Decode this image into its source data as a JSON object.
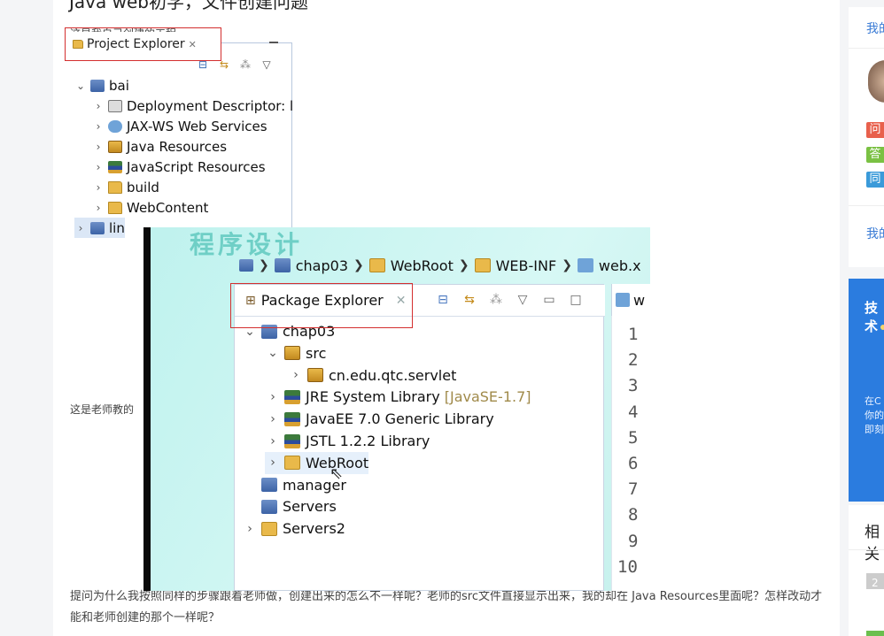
{
  "page": {
    "question_title": "Java web初学，文件创建问题",
    "caption_mine": "这是我自己创建的工程",
    "caption_teacher": "这是老师教的",
    "question_body": "提问为什么我按照同样的步骤跟着老师做，创建出来的怎么不一样呢？老师的src文件直接显示出来，我的却在 Java Resources里面呢？怎样改动才能和老师创建的那个一样呢？"
  },
  "my_project_explorer": {
    "tab_label": "Project Explorer",
    "tab_close": "✕",
    "toolbar_icons": [
      "collapse-all-icon",
      "link-editor-icon",
      "filters-icon",
      "view-menu-icon"
    ],
    "tree": [
      {
        "label": "bai",
        "indent": 0,
        "expanded": true,
        "icon": "project-icon"
      },
      {
        "label": "Deployment Descriptor: l",
        "indent": 1,
        "icon": "descriptor-icon"
      },
      {
        "label": "JAX-WS Web Services",
        "indent": 1,
        "icon": "webservice-icon"
      },
      {
        "label": "Java Resources",
        "indent": 1,
        "icon": "java-resources-icon"
      },
      {
        "label": "JavaScript Resources",
        "indent": 1,
        "icon": "library-icon"
      },
      {
        "label": "build",
        "indent": 1,
        "icon": "folder-icon"
      },
      {
        "label": "WebContent",
        "indent": 1,
        "icon": "folder-icon"
      },
      {
        "label": "lin",
        "indent": 0,
        "expanded": false,
        "icon": "project-icon",
        "selected": true
      }
    ]
  },
  "teacher_eclipse": {
    "watermark": "程序设计",
    "breadcrumb": [
      "chap03",
      "WebRoot",
      "WEB-INF",
      "web.x"
    ],
    "package_explorer": {
      "tab_label": "Package Explorer",
      "tab_close": "✕",
      "tree": [
        {
          "label": "chap03",
          "indent": 0,
          "expanded": true,
          "icon": "project-icon"
        },
        {
          "label": "src",
          "indent": 1,
          "expanded": true,
          "icon": "source-folder-icon"
        },
        {
          "label": "cn.edu.qtc.servlet",
          "indent": 2,
          "icon": "package-icon"
        },
        {
          "label": "JRE System Library",
          "suffix": "[JavaSE-1.7]",
          "indent": 1,
          "icon": "library-icon"
        },
        {
          "label": "JavaEE 7.0 Generic Library",
          "indent": 1,
          "icon": "library-icon"
        },
        {
          "label": "JSTL 1.2.2 Library",
          "indent": 1,
          "icon": "library-icon"
        },
        {
          "label": "WebRoot",
          "indent": 1,
          "icon": "folder-icon",
          "selected": true
        },
        {
          "label": "manager",
          "indent": 0,
          "icon": "project-folder-icon"
        },
        {
          "label": "Servers",
          "indent": 0,
          "icon": "project-folder-icon"
        },
        {
          "label": "Servers2",
          "indent": 0,
          "icon": "folder-icon"
        }
      ]
    },
    "editor_tab_label": "w",
    "line_numbers": [
      "1",
      "2",
      "3",
      "4",
      "5",
      "6",
      "7",
      "8",
      "9",
      "10"
    ]
  },
  "sidebar": {
    "link_top": "我的",
    "badges": [
      {
        "text": "问",
        "color": "#e8604c"
      },
      {
        "text": "答",
        "color": "#7ac143"
      },
      {
        "text": "同",
        "color": "#3a9ad9"
      }
    ],
    "link_bottom": "我的",
    "tech_title": "技术",
    "tech_lines": [
      "在C",
      "你的",
      "即刻"
    ],
    "related_title": "相关",
    "chip_text": "2"
  }
}
